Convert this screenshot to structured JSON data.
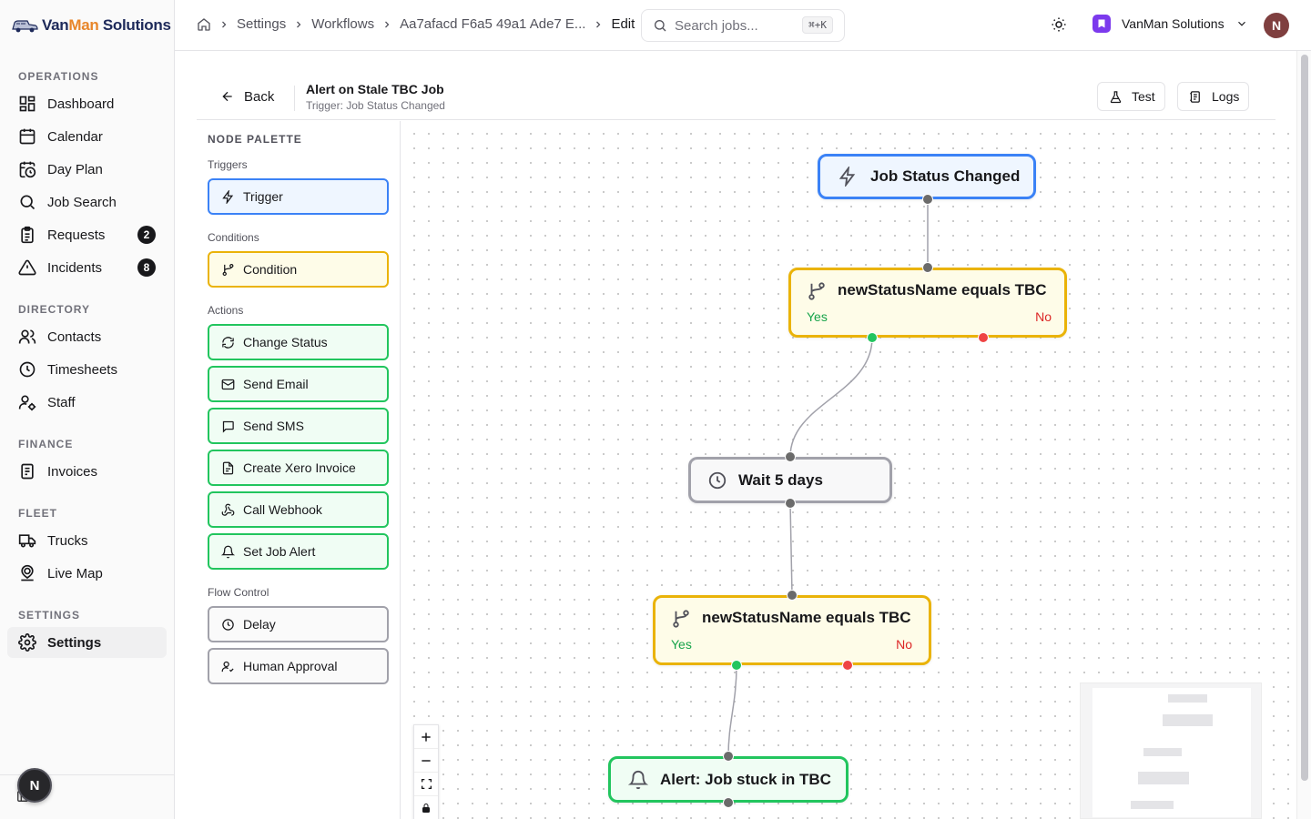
{
  "brand": {
    "part1": "Van",
    "part2": "Man",
    "part3": " Solutions"
  },
  "sidebar": {
    "sections": {
      "operations": "OPERATIONS",
      "directory": "DIRECTORY",
      "finance": "FINANCE",
      "fleet": "FLEET",
      "settings": "SETTINGS"
    },
    "items": [
      {
        "label": "Dashboard",
        "icon": "dashboard-icon"
      },
      {
        "label": "Calendar",
        "icon": "calendar-icon"
      },
      {
        "label": "Day Plan",
        "icon": "calendar-clock-icon"
      },
      {
        "label": "Job Search",
        "icon": "search-icon"
      },
      {
        "label": "Requests",
        "icon": "clipboard-icon",
        "badge": "2"
      },
      {
        "label": "Incidents",
        "icon": "warning-icon",
        "badge": "8"
      },
      {
        "label": "Contacts",
        "icon": "users-icon"
      },
      {
        "label": "Timesheets",
        "icon": "clock-icon"
      },
      {
        "label": "Staff",
        "icon": "user-cog-icon"
      },
      {
        "label": "Invoices",
        "icon": "receipt-icon"
      },
      {
        "label": "Trucks",
        "icon": "truck-icon"
      },
      {
        "label": "Live Map",
        "icon": "map-pin-icon"
      },
      {
        "label": "Settings",
        "icon": "gear-icon"
      }
    ],
    "avatar_initial": "N"
  },
  "header": {
    "breadcrumbs": [
      "Settings",
      "Workflows",
      "Aa7afacd F6a5 49a1 Ade7 E...",
      "Edit"
    ],
    "search_placeholder": "Search jobs...",
    "search_shortcut": "⌘+K",
    "org_name": "VanMan Solutions",
    "user_initial": "N"
  },
  "toolbar": {
    "back_label": "Back",
    "workflow_title": "Alert on Stale TBC Job",
    "workflow_subtitle": "Trigger: Job Status Changed",
    "test_label": "Test",
    "logs_label": "Logs"
  },
  "palette": {
    "title": "NODE PALETTE",
    "groups": {
      "triggers": "Triggers",
      "conditions": "Conditions",
      "actions": "Actions",
      "flow": "Flow Control"
    },
    "items": {
      "trigger": "Trigger",
      "condition": "Condition",
      "change_status": "Change Status",
      "send_email": "Send Email",
      "send_sms": "Send SMS",
      "create_xero_invoice": "Create Xero Invoice",
      "call_webhook": "Call Webhook",
      "set_job_alert": "Set Job Alert",
      "delay": "Delay",
      "human_approval": "Human Approval"
    }
  },
  "canvas": {
    "nodes": {
      "trigger": "Job Status Changed",
      "condition1": "newStatusName equals TBC",
      "wait": "Wait 5 days",
      "condition2": "newStatusName equals TBC",
      "alert": "Alert: Job stuck in TBC"
    },
    "branch_yes": "Yes",
    "branch_no": "No"
  },
  "colors": {
    "trigger": "#3b82f6",
    "condition": "#eab308",
    "action": "#22c55e",
    "flow": "#a1a1aa",
    "yes": "#16a34a",
    "no": "#dc2626"
  }
}
